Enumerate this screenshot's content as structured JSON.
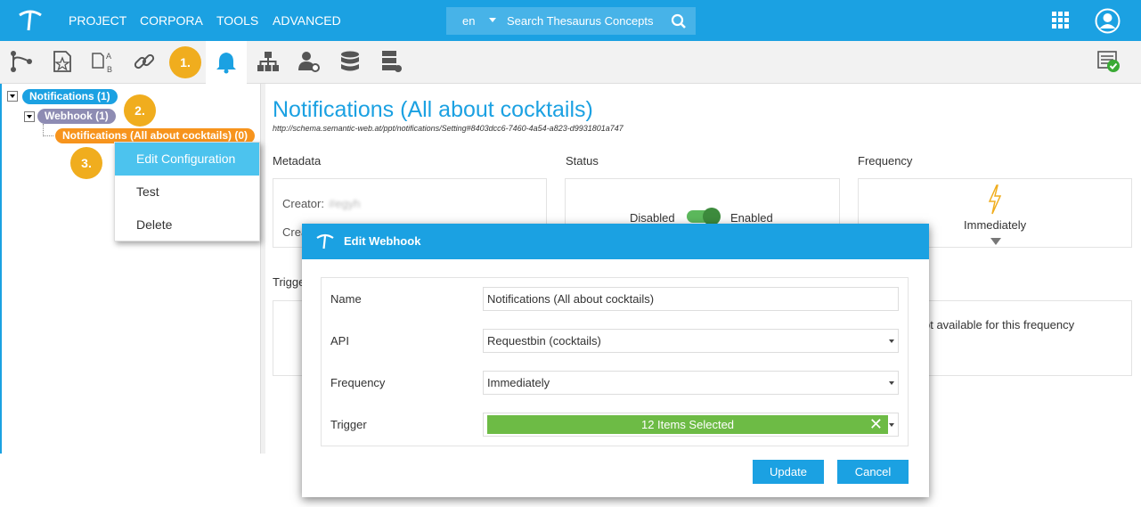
{
  "topbar": {
    "menu": [
      "PROJECT",
      "CORPORA",
      "TOOLS",
      "ADVANCED"
    ],
    "search": {
      "language": "en",
      "placeholder": "Search Thesaurus Concepts"
    },
    "icons": [
      "apps-grid-icon",
      "user-profile-icon"
    ]
  },
  "toolbar": {
    "icons": [
      "hierarchy-icon",
      "star-page-icon",
      "ab-mapping-icon",
      "link-icon",
      "bell-icon",
      "org-chart-icon",
      "user-settings-icon",
      "database-icon",
      "server-icon",
      "checked-list-icon"
    ],
    "active": "bell-icon"
  },
  "steps": [
    "1.",
    "2.",
    "3."
  ],
  "tree": {
    "root": "Notifications (1)",
    "child": "Webhook (1)",
    "leaf": "Notifications (All about cocktails) (0)"
  },
  "context_menu": {
    "items": [
      "Edit Configuration",
      "Test",
      "Delete"
    ],
    "selected": "Edit Configuration"
  },
  "main": {
    "title": "Notifications (All about cocktails)",
    "uri": "http://schema.semantic-web.at/ppt/notifications/Setting#8403dcc6-7460-4a54-a823-d9931801a747",
    "metadata_label": "Metadata",
    "status_label": "Status",
    "frequency_label": "Frequency",
    "creator_label": "Creator:",
    "creator_value": "#egyh",
    "created_label": "Crea",
    "status_off": "Disabled",
    "status_on": "Enabled",
    "frequency_value": "Immediately",
    "trigger_label": "Trigge",
    "trigger_note": "ot available for this frequency"
  },
  "dialog": {
    "title": "Edit Webhook",
    "fields": {
      "name_label": "Name",
      "name_value": "Notifications (All about cocktails)",
      "api_label": "API",
      "api_value": "Requestbin (cocktails)",
      "frequency_label": "Frequency",
      "frequency_value": "Immediately",
      "trigger_label": "Trigger",
      "trigger_value": "12 Items Selected"
    },
    "update_label": "Update",
    "cancel_label": "Cancel"
  },
  "colors": {
    "brand": "#1ba1e2",
    "step": "#f0ad1e",
    "leaf": "#f7941d",
    "trigger": "#6dbb45"
  }
}
